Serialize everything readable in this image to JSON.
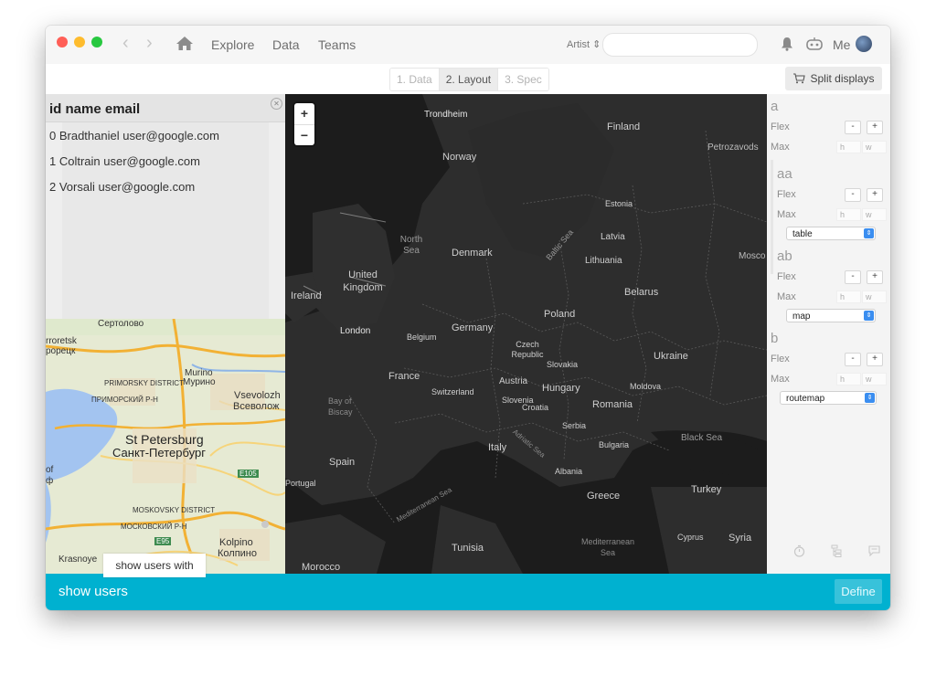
{
  "nav": {
    "explore": "Explore",
    "data": "Data",
    "teams": "Teams"
  },
  "artist_label": "Artist",
  "user_label": "Me",
  "tabs": [
    "1. Data",
    "2. Layout",
    "3. Spec"
  ],
  "split_button": "Split displays",
  "table": {
    "header": "id name email",
    "rows": [
      "0 Bradthaniel user@google.com",
      "1 Coltrain user@google.com",
      "2 Vorsali user@google.com"
    ]
  },
  "dark_map_labels": {
    "countries": [
      "Finland",
      "Norway",
      "Estonia",
      "Latvia",
      "Lithuania",
      "Denmark",
      "United Kingdom",
      "Ireland",
      "Belarus",
      "Poland",
      "Germany",
      "Czech Republic",
      "Slovakia",
      "Ukraine",
      "France",
      "Switzerland",
      "Austria",
      "Hungary",
      "Slovenia",
      "Croatia",
      "Moldova",
      "Romania",
      "Serbia",
      "Bulgaria",
      "Italy",
      "Spain",
      "Portugal",
      "Albania",
      "Greece",
      "Turkey",
      "Cyprus",
      "Syria",
      "Tunisia",
      "Morocco",
      "Belgium"
    ],
    "seas": [
      "North Sea",
      "Baltic Sea",
      "Bay of Biscay",
      "Adriatic Sea",
      "Black Sea",
      "Mediterranean Sea",
      "Mediterranean Sea"
    ],
    "cities": [
      "Trondheim",
      "Petrozavods",
      "London",
      "Mosco"
    ]
  },
  "zoom": {
    "plus": "+",
    "minus": "−"
  },
  "light_map_labels": [
    "Сертолово",
    "rroretsk",
    "рорецк",
    "PRIMORSKY DISTRICT",
    "ПРИМОРСКИЙ Р-Н",
    "Murino",
    "Мурино",
    "Vsevolozh",
    "Всеволож",
    "St Petersburg",
    "Санкт-Петербург",
    "MOSKOVSKY DISTRICT",
    "МОСКОВСКИЙ Р-Н",
    "E105",
    "E95",
    "Kolpino",
    "Колпино",
    "Krasnoye",
    "of",
    "ф"
  ],
  "right_panel": {
    "sections": [
      {
        "name": "a",
        "flex": "Flex",
        "max": "Max"
      },
      {
        "name": "aa",
        "flex": "Flex",
        "max": "Max",
        "select": "table"
      },
      {
        "name": "ab",
        "flex": "Flex",
        "max": "Max",
        "select": "map"
      },
      {
        "name": "b",
        "flex": "Flex",
        "max": "Max",
        "select": "routemap"
      }
    ],
    "minus": "-",
    "plus": "+",
    "h": "h",
    "w": "w"
  },
  "tooltip": "show users with",
  "bottom": {
    "text": "show users",
    "define": "Define"
  },
  "colors": {
    "accent": "#00b1d0",
    "select_arrow": "#3b8ef0",
    "close": "#ff5f57",
    "minimize": "#febc2e",
    "zoom": "#28c840"
  }
}
